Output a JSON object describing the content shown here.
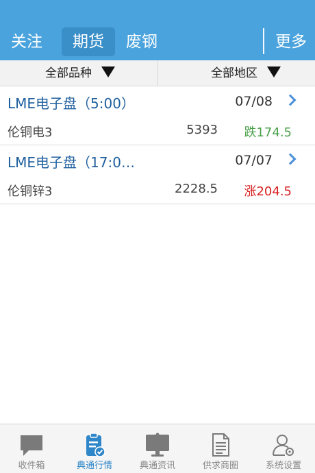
{
  "header": {
    "tabs": [
      {
        "label": "关注"
      },
      {
        "label": "期货"
      },
      {
        "label": "废钢"
      }
    ],
    "more_label": "更多",
    "active_tab": "期货"
  },
  "filters": {
    "variety": "全部品种",
    "region": "全部地区"
  },
  "markets": [
    {
      "name": "LME电子盘（5:00）",
      "date": "07/08",
      "rows": [
        {
          "name": "伦铜电3",
          "price": "5393",
          "change": "跌174.5",
          "direction": "down"
        }
      ]
    },
    {
      "name": "LME电子盘（17:0…",
      "date": "07/07",
      "rows": [
        {
          "name": "伦铜锌3",
          "price": "2228.5",
          "change": "涨204.5",
          "direction": "up"
        }
      ]
    }
  ],
  "tabbar": {
    "items": [
      {
        "label": "收件箱",
        "icon": "chat-bubble-icon"
      },
      {
        "label": "典通行情",
        "icon": "clipboard-check-icon"
      },
      {
        "label": "典通资讯",
        "icon": "monitor-icon"
      },
      {
        "label": "供求商圈",
        "icon": "document-icon"
      },
      {
        "label": "系统设置",
        "icon": "user-gear-icon"
      }
    ],
    "active": "典通行情"
  },
  "colors": {
    "header_bg": "#4aa3dd",
    "active_tab_bg": "#3a8fc8",
    "market_name": "#1e5f9e",
    "down": "#4aa04a",
    "up": "#d81e1e",
    "tabbar_active": "#2f86c9",
    "tabbar_inactive": "#888888"
  }
}
